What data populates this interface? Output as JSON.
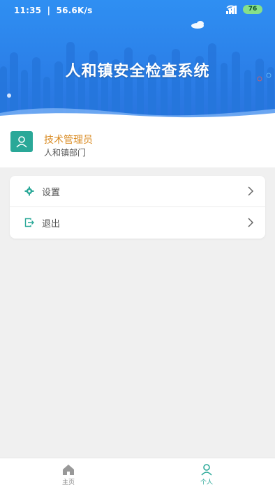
{
  "statusbar": {
    "time": "11:35",
    "speed": "56.6K/s",
    "battery": "76"
  },
  "header": {
    "title": "人和镇安全检查系统"
  },
  "profile": {
    "name": "技术管理员",
    "department": "人和镇部门"
  },
  "menu": {
    "items": [
      {
        "label": "设置",
        "icon": "gear-icon"
      },
      {
        "label": "退出",
        "icon": "logout-icon"
      }
    ]
  },
  "bottom_nav": {
    "items": [
      {
        "label": "主页",
        "icon": "home-icon"
      },
      {
        "label": "个人",
        "icon": "user-icon",
        "active": true
      }
    ]
  },
  "colors": {
    "header_blue": "#2f8ff2",
    "accent_teal": "#2aa898",
    "name_orange": "#d98a20"
  }
}
